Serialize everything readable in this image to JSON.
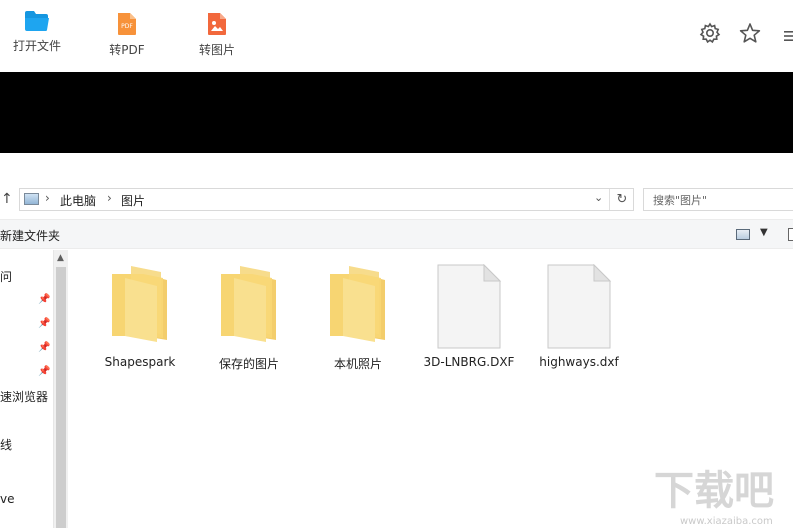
{
  "toolbar": {
    "open_label": "打开文件",
    "to_pdf_label": "转PDF",
    "to_image_label": "转图片",
    "pdf_badge": "PDF",
    "icons": {
      "open": "folder-open-icon",
      "to_pdf": "pdf-file-icon",
      "to_image": "image-file-icon",
      "settings": "gear-icon",
      "favorite": "star-icon",
      "menu": "menu-icon"
    },
    "colors": {
      "open_icon": "#1ea5f0",
      "pdf_icon": "#f7923a",
      "image_icon": "#f2683c"
    }
  },
  "explorer": {
    "breadcrumb": [
      "此电脑",
      "图片"
    ],
    "search_placeholder": "搜索\"图片\"",
    "command_new_folder": "新建文件夹",
    "nav_items": [
      "问",
      "速浏览器",
      "线",
      "ve"
    ],
    "items": [
      {
        "name": "Shapespark",
        "type": "folder"
      },
      {
        "name": "保存的图片",
        "type": "folder"
      },
      {
        "name": "本机照片",
        "type": "folder"
      },
      {
        "name": "3D-LNBRG.DXF",
        "type": "file"
      },
      {
        "name": "highways.dxf",
        "type": "file"
      }
    ]
  },
  "watermark": {
    "text": "下载吧",
    "url_text": "www.xiazaiba.com"
  }
}
